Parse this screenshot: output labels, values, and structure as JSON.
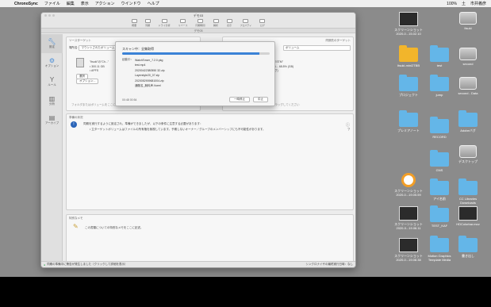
{
  "menubar": {
    "app": "ChronoSync",
    "items": [
      "ファイル",
      "編集",
      "表示",
      "アクション",
      "ウインドウ",
      "ヘルプ"
    ],
    "battery": "100%",
    "clock": "土",
    "user": "市井義彦"
  },
  "window": {
    "title": "デモ03",
    "subtitle": "デモ03",
    "toolbar": [
      "概要",
      "同期",
      "ドライ分析",
      "リバース",
      "同期時間",
      "解析",
      "表示",
      "プロパティ",
      "ログ"
    ],
    "sidebar": [
      {
        "label": "設定",
        "icon": "wrench-icon"
      },
      {
        "label": "オプション",
        "icon": "gear-icon"
      },
      {
        "label": "ルール",
        "icon": "rules-icon"
      },
      {
        "label": "分析",
        "icon": "chart-icon"
      },
      {
        "label": "アーカイブ",
        "icon": "archive-icon"
      }
    ],
    "target_left": {
      "title": "ソースターゲット",
      "volume_label": "場所名:",
      "volume_value": "マウントされたボリューム",
      "path_text": "\"Itsuki\"の\"Ch...\"",
      "bullets": [
        "• 300.11 GB",
        "• APFS"
      ],
      "choose_button": "選択",
      "options_button": "オプション..."
    },
    "target_right": {
      "options_link": "同期先のターゲット",
      "volume_value": "ボリューム",
      "path_text": "\"HIZTRE\"の\"TESTM\"",
      "detail_1": "GB 使用 58.9%... 68.8% (GB)",
      "detail_2": "(ジャーナリング)"
    },
    "options": {
      "checkbox_1": "削除項目を同期",
      "checkbox_2": "置換したファイルをアーカイブ"
    },
    "drop_hint_left": "フォルダまたはボリュームをここにドラッグしてください",
    "drop_hint_right": "フォルダまたはボリュームをここにドラッグしてください",
    "ready": {
      "title": "準備の状況",
      "message": "同期を実行するように設定され、準備ができましたが、以下の条件に注意する必要があります：",
      "bullet": "• 立ターゲットボリュームはファイルの所有権を無視しています。予期しないオーナー／グループのメンバーシップにも不可能性があります。"
    },
    "notes": {
      "title": "特別なメモ",
      "text": "この書類についての特別なメモをここに記述。"
    },
    "status_left": "同期の準備中に警告が発生しました（クリックして詳細を表示）",
    "status_right": "シンクロナイザの最終実行日時：なし"
  },
  "scan_sheet": {
    "title": "スキャン中：全集取得",
    "progress": 0.93,
    "start_label": "起動中：",
    "files": [
      "WatchTower_7.2.0.pkg",
      "test.mp4",
      "20200422380550 32.zip",
      "Layerstyle20_07.zip",
      "2020052909681004.zip",
      "通販名_無料声.Voeel"
    ],
    "stats": "00:48    00:54",
    "stop_button": "一時停止",
    "cancel_button": "中止"
  },
  "desktop_icons": [
    {
      "label": "スクリーンショット\n2020-0...15.02.10",
      "kind": "shot"
    },
    {
      "label": "Itsuki",
      "kind": "drive"
    },
    {
      "label": "Itsuki-mini2TBB",
      "kind": "folder-yellow"
    },
    {
      "label": "test",
      "kind": "folder"
    },
    {
      "label": "second",
      "kind": "drive"
    },
    {
      "label": "プロジェクト",
      "kind": "folder"
    },
    {
      "label": "jump",
      "kind": "folder"
    },
    {
      "label": "second - Data",
      "kind": "drive"
    },
    {
      "label": "プレミアノート",
      "kind": "folder"
    },
    {
      "label": "RECORD",
      "kind": "folder"
    },
    {
      "label": "Adobeバグ",
      "kind": "folder"
    },
    {
      "label": "GNS",
      "kind": "folder"
    },
    {
      "label": "デスクトップ",
      "kind": "drive"
    },
    {
      "label": "スクリーンショット\n2020-0...19.05.59",
      "kind": "orange"
    },
    {
      "label": "アイ名前",
      "kind": "folder"
    },
    {
      "label": "CC Libraries\nDownloads",
      "kind": "folder"
    },
    {
      "label": "スクリーンショット\n2020-0...19.06.11",
      "kind": "shot"
    },
    {
      "label": "TEST_KAF",
      "kind": "folder"
    },
    {
      "label": "HDColorbar.mov",
      "kind": "shot"
    },
    {
      "label": "スクリーンショット\n2020-0...19.08.38",
      "kind": "shot"
    },
    {
      "label": "Motion Graphics\nTemplate Media",
      "kind": "folder"
    },
    {
      "label": "書き出し",
      "kind": "folder"
    }
  ],
  "colors": {
    "accent": "#3b82d6",
    "folder": "#64b6e8",
    "folder_yellow": "#f2b52b"
  }
}
